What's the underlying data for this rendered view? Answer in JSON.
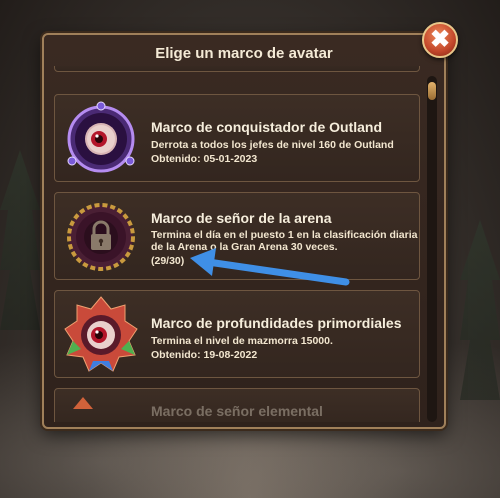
{
  "dialog": {
    "title": "Elige un marco de avatar",
    "close_label": "✖"
  },
  "frames": [
    {
      "name": "Marco de conquistador de Outland",
      "description": "Derrota a todos los jefes de nivel 160 de Outland",
      "obtained": "Obtenido: 05-01-2023",
      "icon": "purple-eye-frame-icon"
    },
    {
      "name": "Marco de señor de la arena",
      "description": "Termina el día en el puesto 1 en la clasificación diaria de la Arena o la Gran Arena 30 veces.",
      "progress": "(29/30)",
      "icon": "locked-arena-frame-icon"
    },
    {
      "name": "Marco de profundidades primordiales",
      "description": "Termina el nivel de mazmorra 15000.",
      "obtained": "Obtenido: 19-08-2022",
      "icon": "crystal-eye-frame-icon"
    }
  ],
  "partial_next": {
    "name": "Marco de señor elemental"
  },
  "annotation": {
    "color": "#3f8fe6"
  }
}
